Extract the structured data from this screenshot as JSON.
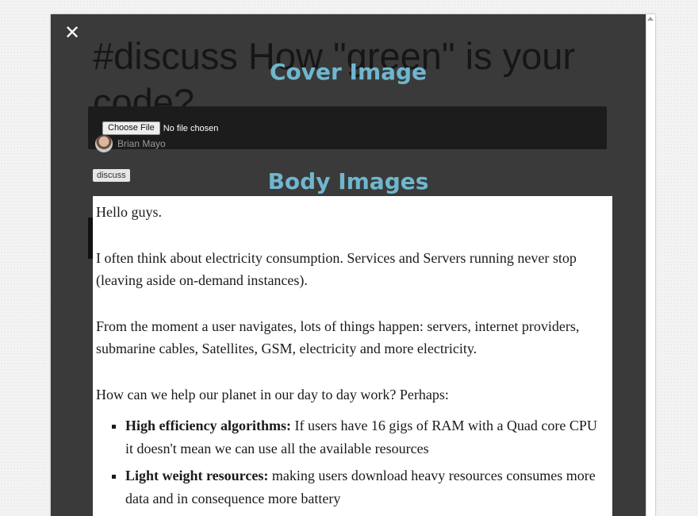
{
  "modal": {
    "close_label": "✕",
    "article_title": "#discuss How \"green\" is your code?",
    "cover_heading": "Cover Image",
    "body_heading": "Body Images",
    "file_input": {
      "button_label": "Choose File",
      "status": "No file chosen"
    },
    "author_name": "Brian Mayo",
    "tag": "discuss"
  },
  "editor": {
    "paragraphs": [
      "Hello guys.",
      "I often think about electricity consumption. Services and Servers running never stop (leaving aside on-demand instances).",
      "From the moment a user navigates, lots of things happen: servers, internet providers, submarine cables, Satellites, GSM, electricity and more electricity.",
      "How can we help our planet in our day to day work? Perhaps:"
    ],
    "list": [
      {
        "title": "High efficiency algorithms:",
        "text": " If users have 16 gigs of RAM with a Quad core CPU it doesn't mean we can use all the available resources"
      },
      {
        "title": "Light weight resources:",
        "text": " making users download heavy resources consumes more data and in consequence more battery"
      }
    ]
  },
  "colors": {
    "modal_background": "#3a3a3a",
    "heading_accent": "#6fb7cf",
    "cover_panel": "#1c1c1c"
  }
}
